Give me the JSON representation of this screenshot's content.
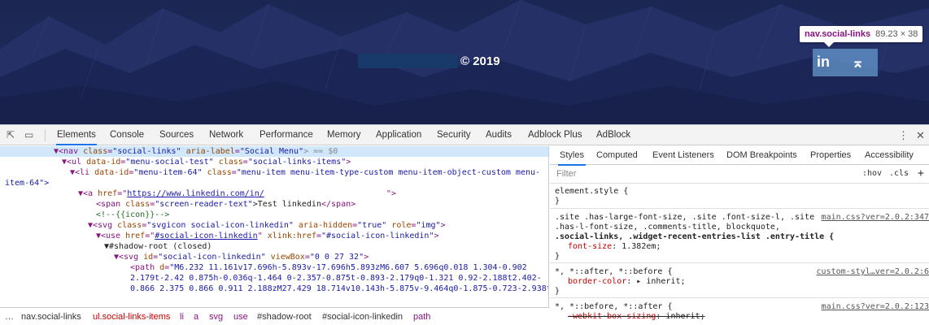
{
  "page": {
    "copyright": "© 2019",
    "social_icons": [
      {
        "name": "linkedin-icon",
        "glyph": "in"
      },
      {
        "name": "back-to-top-icon",
        "glyph": "⌅"
      }
    ],
    "inspector_tooltip": {
      "selector": "nav.social-links",
      "dimensions": "89.23 × 38"
    },
    "colors": {
      "background": "#1f2a5a",
      "highlight": "#6fa8dc",
      "accent": "#1a73e8"
    }
  },
  "devtools": {
    "tools": {
      "inspect": "⇱",
      "device": "▭"
    },
    "tabs": [
      "Elements",
      "Console",
      "Sources",
      "Network",
      "Performance",
      "Memory",
      "Application",
      "Security",
      "Audits",
      "Adblock Plus",
      "AdBlock"
    ],
    "active_tab": "Elements",
    "menu": "⋮",
    "close": "✕",
    "ellipsis": "…",
    "elements_lines": {
      "l1": {
        "open": "▼<nav ",
        "a1": "class",
        "v1": "\"social-links\"",
        "a2": " aria-label",
        "v2": "\"Social Menu\"",
        "end": "> == $0"
      },
      "l2": {
        "open": "▼<ul ",
        "a1": "data-id",
        "v1": "\"menu-social-test\"",
        "a2": " class",
        "v2": "\"social-links-items\"",
        "end": ">"
      },
      "l3": {
        "open": "▼<li ",
        "a1": "data-id",
        "v1": "\"menu-item-64\"",
        "a2": " class",
        "v2": "\"menu-item menu-item-type-custom menu-item-object-custom menu-"
      },
      "l4": {
        "text": "item-64\">"
      },
      "l5": {
        "open": "▼<a ",
        "a1": "href",
        "v1": "https://www.linkedin.com/in/",
        "end": "\">"
      },
      "l6": {
        "open": "<span ",
        "a1": "class",
        "v1": "\"screen-reader-text\"",
        "text": ">Test linkedin",
        "close": "</span>"
      },
      "l7": {
        "comment": "<!--{{icon}}-->"
      },
      "l8": {
        "open": "▼<svg ",
        "a1": "class",
        "v1": "\"svgicon social-icon-linkedin\"",
        "a2": " aria-hidden",
        "v2": "\"true\"",
        "a3": " role",
        "v3": "\"img\"",
        "end": ">"
      },
      "l9": {
        "open": "▼<use ",
        "a1": "href",
        "v1": "#social-icon-linkedin",
        "a2": " xlink:href",
        "v2": "\"#social-icon-linkedin\"",
        "end": ">"
      },
      "l10": {
        "text": "▼#shadow-root (closed)"
      },
      "l11": {
        "open": "▼<svg ",
        "a1": "id",
        "v1": "\"social-icon-linkedin\"",
        "a2": " viewBox",
        "v2": "\"0 0 27 32\"",
        "end": ">"
      },
      "l12": {
        "open": "<path ",
        "a1": "d",
        "v1": "\"M6.232 11.161v17.696h-5.893v-17.696h5.893zM6.607 5.696q0.018 1.304-0.902"
      },
      "l13": {
        "text": "2.179t-2.42 0.875h-0.036q-1.464 0-2.357-0.875t-0.893-2.179q0-1.321 0.92-2.188t2.402-"
      },
      "l14": {
        "text": "0.866 2.375 0.866 0.911 2.188zM27.429 18.714v10.143h-5.875v-9.464q0-1.875-0.723-2.938t-"
      }
    },
    "breadcrumbs": [
      "nav.social-links",
      "ul.social-links-items",
      "li",
      "a",
      "svg",
      "use",
      "#shadow-root",
      "#social-icon-linkedin",
      "path"
    ],
    "styles_tabs": [
      "Styles",
      "Computed",
      "Event Listeners",
      "DOM Breakpoints",
      "Properties",
      "Accessibility"
    ],
    "filter_placeholder": "Filter",
    "filter_hov": ":hov",
    "filter_cls": ".cls",
    "filter_add": "+",
    "rules": {
      "r1": {
        "l1": "element.style {",
        "l2": "}"
      },
      "r2": {
        "l1": ".site .has-large-font-size, .site .font-size-l, .site",
        "l2": ".has-l-font-size, .comments-title, blockquote,",
        "l3": ".social-links, .widget-recent-entries-list .entry-title {",
        "prop": "font-size",
        "val": "1.382em;",
        "close": "}",
        "source": "main.css?ver=2.0.2:347"
      },
      "r3": {
        "l1": "*, *::after, *::before {",
        "prop": "border-color",
        "val": "▸ inherit;",
        "close": "}",
        "source": "custom-styl…ver=2.0.2:6"
      },
      "r4": {
        "l1": "*, *::before, *::after {",
        "prop": "-webkit-box-sizing",
        "val": "inherit;",
        "source": "main.css?ver=2.0.2:123"
      }
    }
  }
}
